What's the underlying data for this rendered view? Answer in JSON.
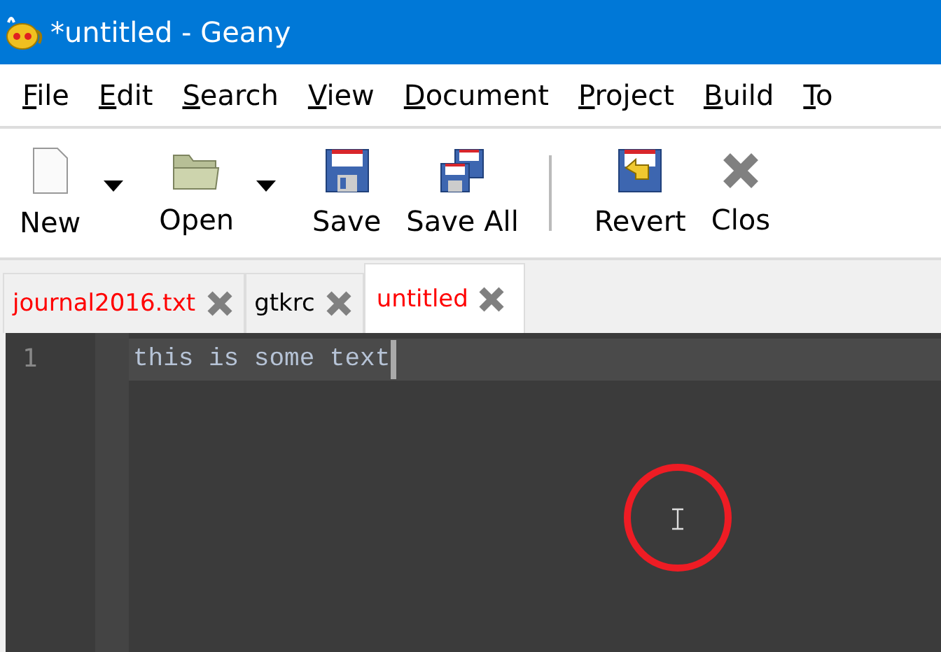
{
  "window": {
    "title": "*untitled - Geany"
  },
  "menu": [
    {
      "label": "File"
    },
    {
      "label": "Edit"
    },
    {
      "label": "Search"
    },
    {
      "label": "View"
    },
    {
      "label": "Document"
    },
    {
      "label": "Project"
    },
    {
      "label": "Build"
    },
    {
      "label": "To"
    }
  ],
  "toolbar": [
    {
      "kind": "new",
      "label": "New",
      "dropdown": true
    },
    {
      "kind": "open",
      "label": "Open",
      "dropdown": true
    },
    {
      "kind": "save",
      "label": "Save",
      "dropdown": false
    },
    {
      "kind": "saveall",
      "label": "Save All",
      "dropdown": false
    },
    {
      "kind": "separator"
    },
    {
      "kind": "revert",
      "label": "Revert",
      "dropdown": false
    },
    {
      "kind": "close",
      "label": "Clos",
      "dropdown": false
    }
  ],
  "tabs": [
    {
      "label": "journal2016.txt",
      "modified": true,
      "selected": false
    },
    {
      "label": "gtkrc",
      "modified": false,
      "selected": false
    },
    {
      "label": "untitled",
      "modified": true,
      "selected": true
    }
  ],
  "editor": {
    "lines": [
      {
        "number": "1",
        "text": "this is some text",
        "current": true
      }
    ]
  }
}
